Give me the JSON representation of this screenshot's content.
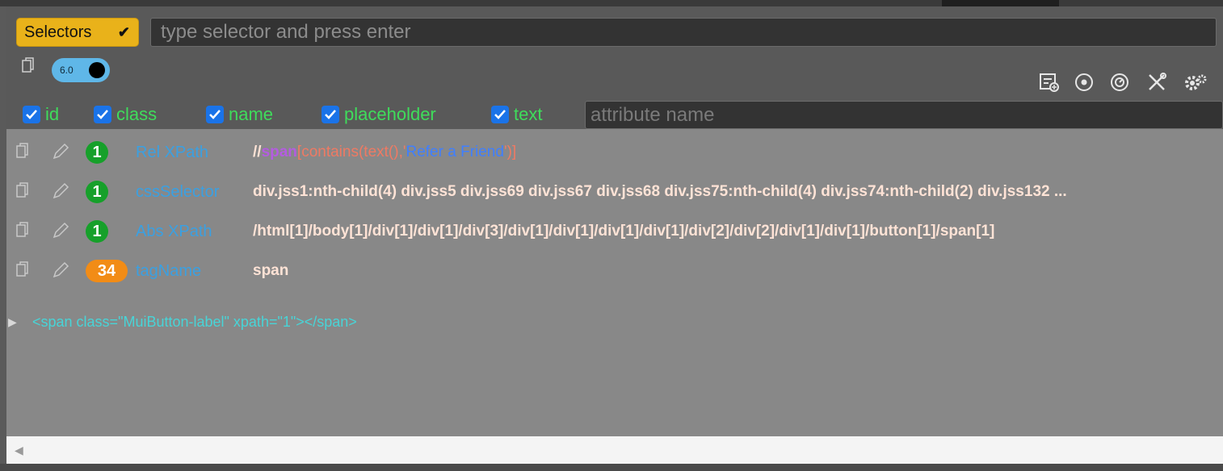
{
  "toolbar": {
    "selectors_label": "Selectors",
    "selector_placeholder": "type selector and press enter",
    "version_label": "6.0"
  },
  "attributes": {
    "items": [
      {
        "label": "id",
        "checked": true
      },
      {
        "label": "class",
        "checked": true
      },
      {
        "label": "name",
        "checked": true
      },
      {
        "label": "placeholder",
        "checked": true
      },
      {
        "label": "text",
        "checked": true
      }
    ],
    "attr_placeholder": "attribute name"
  },
  "results": [
    {
      "count": "1",
      "label": "Rel XPath",
      "value_parts": [
        "//",
        "span",
        "[contains(text(),'",
        "Refer a Friend",
        "')]"
      ]
    },
    {
      "count": "1",
      "label": "cssSelector",
      "value": "div.jss1:nth-child(4) div.jss5 div.jss69 div.jss67 div.jss68 div.jss75:nth-child(4) div.jss74:nth-child(2) div.jss132 ..."
    },
    {
      "count": "1",
      "label": "Abs XPath",
      "value": "/html[1]/body[1]/div[1]/div[1]/div[3]/div[1]/div[1]/div[1]/div[1]/div[2]/div[2]/div[1]/div[1]/button[1]/span[1]"
    },
    {
      "count": "34",
      "label": "tagName",
      "value": "span"
    }
  ],
  "html_preview": "<span class=\"MuiButton-label\" xpath=\"1\"></span>",
  "colors": {
    "accent": "#e9b21a",
    "checkbox": "#1a73e8",
    "attr_label": "#3fdc5b",
    "result_label": "#3aa0e2",
    "badge_green": "#16a02a",
    "badge_orange": "#f28c16"
  },
  "icons": [
    "copy-icon",
    "edit-icon",
    "add-list-icon",
    "target-icon",
    "speed-icon",
    "tools-icon",
    "settings-icon",
    "chevron-down-icon"
  ]
}
